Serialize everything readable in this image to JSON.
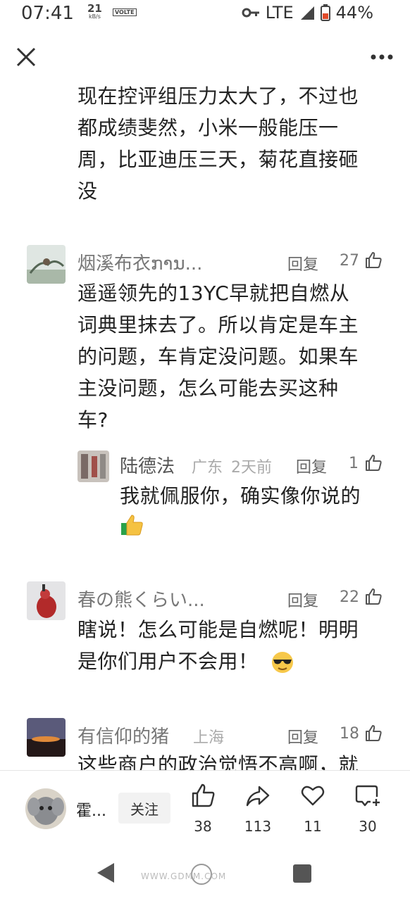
{
  "status": {
    "time": "07:41",
    "speed_value": "21",
    "speed_unit": "kB/s",
    "volte": "VOLTE",
    "network": "LTE",
    "battery": "44%"
  },
  "comments": {
    "top_text_lines": [
      "现在控评组压力太大了，不过也",
      "都成绩斐然，小米一般能压一",
      "周，比亚迪压三天，菊花直接砸",
      "没"
    ],
    "c1": {
      "name": "烟溪布衣ການ...",
      "reply": "回复",
      "likes": "27",
      "lines": [
        "遥遥领先的13YC早就把自燃从",
        "词典里抹去了。所以肯定是车主",
        "的问题，车肯定没问题。如果车",
        "主没问题，怎么可能去买这种",
        "车?"
      ],
      "sub": {
        "name": "陆德法",
        "location": "广东",
        "time": "2天前",
        "reply": "回复",
        "likes": "1",
        "text": "我就佩服你，确实像你说的"
      }
    },
    "c2": {
      "name": "春の熊くらい...",
      "reply": "回复",
      "likes": "22",
      "lines": [
        "瞎说！怎么可能是自燃呢！明明",
        "是你们用户不会用！"
      ]
    },
    "c3": {
      "name": "有信仰的猪",
      "location": "上海",
      "reply": "回复",
      "likes": "18",
      "partial": "这些商户的政治觉悟不高啊，就"
    }
  },
  "bottom": {
    "author": "霍...",
    "follow": "关注",
    "likes": "38",
    "shares": "113",
    "favorites": "11",
    "comments": "30"
  },
  "watermark": "WWW.GDMM.COM",
  "colors": {
    "text": "#222222",
    "meta": "#aaaaaa",
    "divider": "#e5e5e5",
    "battery": "#e04a2a"
  }
}
